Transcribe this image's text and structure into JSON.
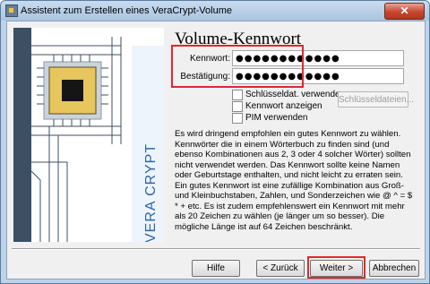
{
  "window": {
    "title": "Assistent zum Erstellen eines VeraCrypt-Volume",
    "close_symbol": "✕"
  },
  "side_image": {
    "logo_text": "VERA CRYPT"
  },
  "page": {
    "heading": "Volume-Kennwort"
  },
  "fields": {
    "password_label": "Kennwort:",
    "password_value": "●●●●●●●●●●●●",
    "confirm_label": "Bestätigung:",
    "confirm_value": "●●●●●●●●●●●●"
  },
  "options": {
    "use_keyfiles": "Schlüsseldat. verwenden",
    "show_password": "Kennwort anzeigen",
    "use_pim": "PIM verwenden",
    "keyfiles_button": "Schlüsseldateien..."
  },
  "info": "Es wird dringend empfohlen ein gutes Kennwort zu wählen. Kennwörter die in einem Wörterbuch zu finden sind (und ebenso Kombinationen aus 2, 3 oder 4 solcher Wörter) sollten nicht verwendet werden. Das Kennwort sollte keine Namen oder Geburtstage enthalten, und nicht leicht zu erraten sein. Ein gutes Kennwort ist eine zufällige Kombination aus Groß- und Kleinbuchstaben, Zahlen, und Sonderzeichen wie @ ^ = $ * + etc. Es ist zudem empfehlenswert ein Kennwort mit mehr als 20 Zeichen zu wählen (je länger um so besser). Die mögliche Länge ist auf 64 Zeichen beschränkt.",
  "buttons": {
    "help": "Hilfe",
    "back": "< Zurück",
    "next": "Weiter >",
    "cancel": "Abbrechen"
  },
  "colors": {
    "highlight": "#e0282e",
    "logo_blue": "#2b66b0"
  }
}
